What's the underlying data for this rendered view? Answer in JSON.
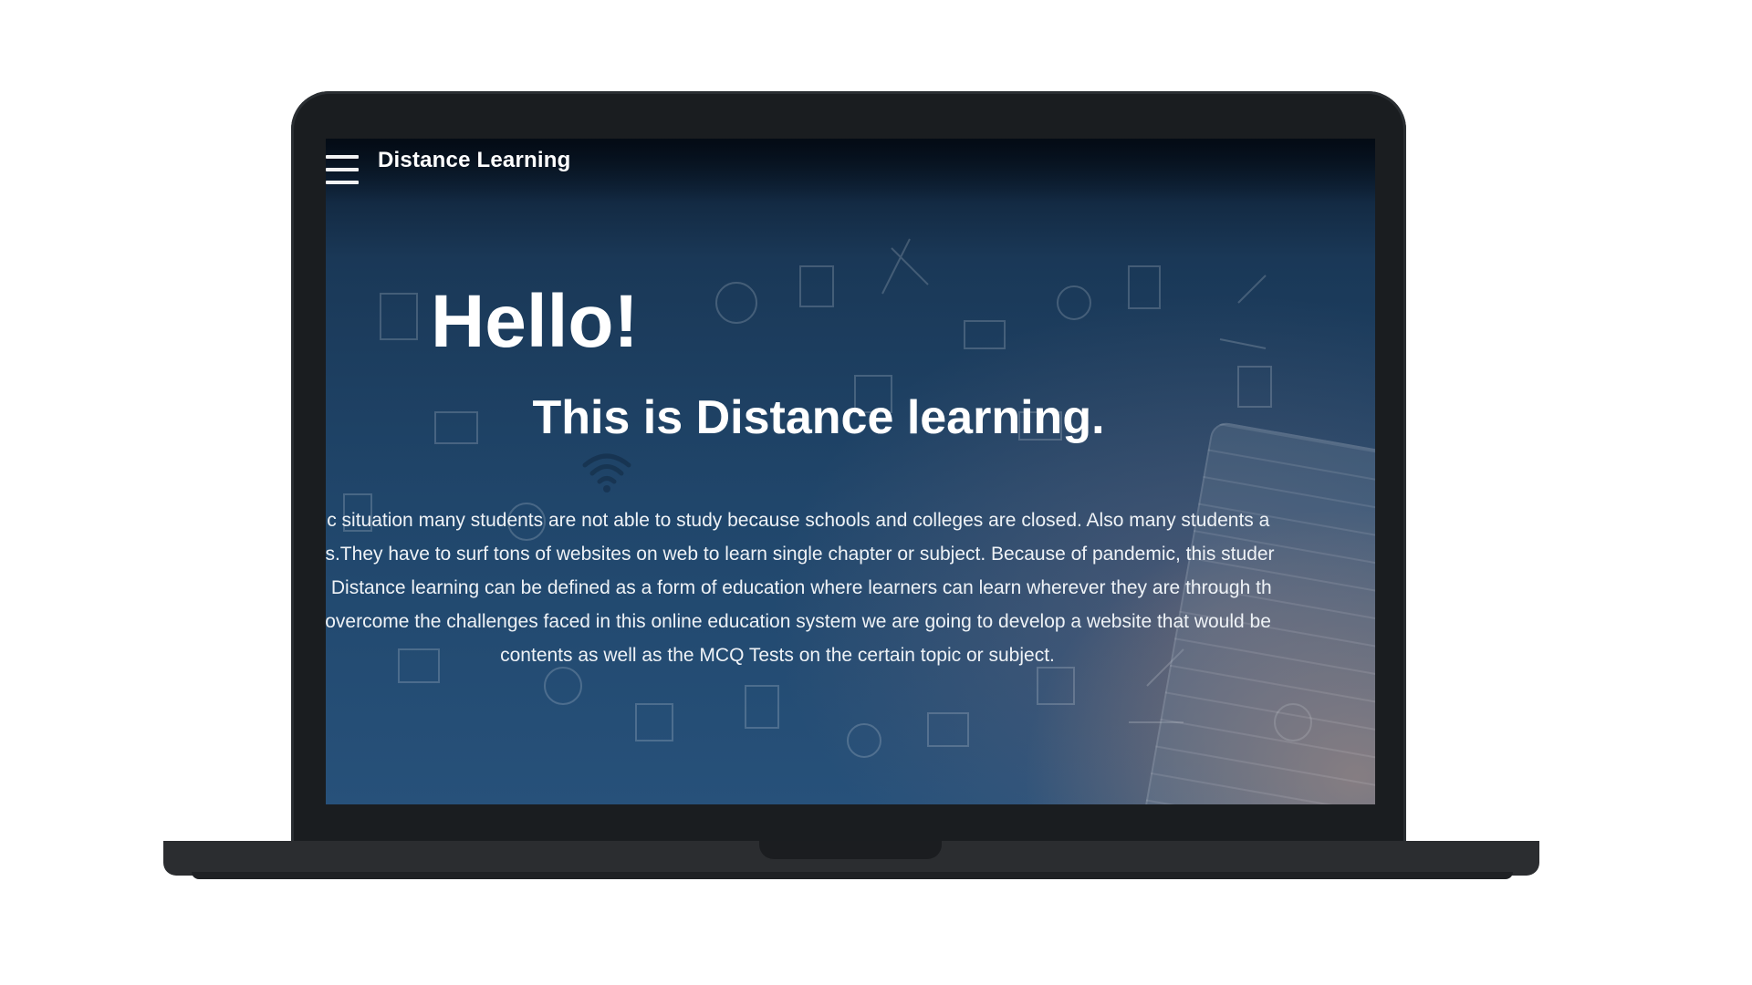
{
  "header": {
    "brand": "Distance Learning",
    "menu_icon": "hamburger-menu-icon"
  },
  "hero": {
    "greeting": "Hello!",
    "subtitle": "This is Distance learning.",
    "intro_lines": [
      "demic situation many students are not able to study because schools and colleges are closed. Also many students a",
      "lasses.They have to surf tons of websites on web to learn single chapter or subject. Because of pandemic, this studer",
      "nger. Distance learning can be defined as a form of education where learners can learn wherever they are through th",
      "/. To overcome the challenges faced in this online education system we are going to develop a website that would be",
      "contents as well as the MCQ Tests on the certain topic or subject."
    ]
  },
  "colors": {
    "background_top": "#0b1a2c",
    "background_bottom": "#27517a",
    "accent_warm": "#d09678",
    "text": "#ffffff",
    "device_frame": "#1a1d20"
  }
}
